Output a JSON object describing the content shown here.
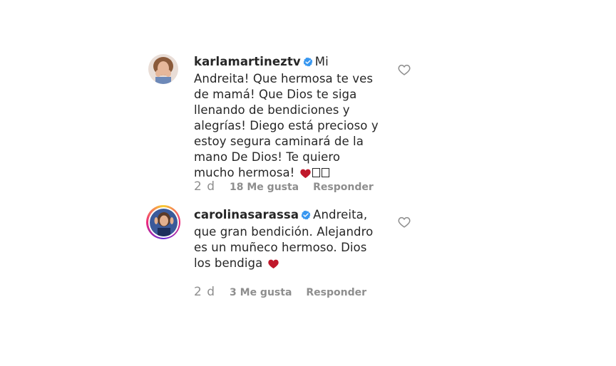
{
  "comments": [
    {
      "username": "karlamartineztv",
      "text": "Mi Andreita! Que hermosa te ves de mamá! Que Dios te siga llenando de bendiciones y alegrías! Diego está precioso y estoy segura caminará de la mano De Dios! Te quiero mucho hermosa!",
      "time": "2 d",
      "likes": "18 Me gusta",
      "reply_label": "Responder"
    },
    {
      "username": "carolinasarassa",
      "text": "Andreita, que gran bendición. Alejandro es un muñeco hermoso. Dios los bendiga",
      "time": "2 d",
      "likes": "3 Me gusta",
      "reply_label": "Responder"
    }
  ],
  "colors": {
    "text": "#262626",
    "secondary": "#8e8e8e",
    "verified": "#3897f0",
    "heart": "#c0182b"
  },
  "icons": {
    "verified": "verified-badge-icon",
    "like": "heart-outline-icon",
    "emoji_heart": "red-heart-emoji-icon"
  }
}
